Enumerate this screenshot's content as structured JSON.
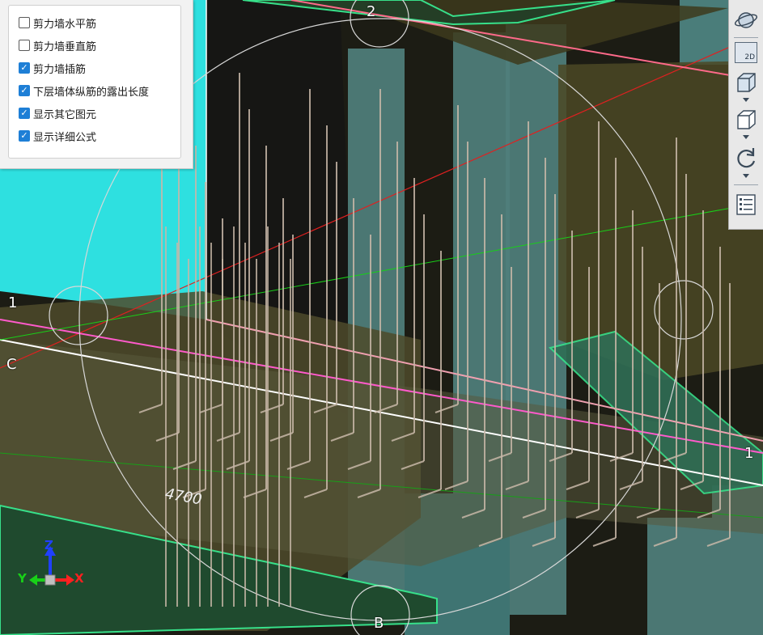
{
  "options": [
    {
      "label": "剪力墙水平筋",
      "checked": false
    },
    {
      "label": "剪力墙垂直筋",
      "checked": false
    },
    {
      "label": "剪力墙插筋",
      "checked": true
    },
    {
      "label": "下层墙体纵筋的露出长度",
      "checked": true
    },
    {
      "label": "显示其它图元",
      "checked": true
    },
    {
      "label": "显示详细公式",
      "checked": true
    }
  ],
  "viewport": {
    "grid_labels": {
      "top": "2",
      "left": "1",
      "right": "1",
      "left_axis": "C",
      "bottom": "B"
    },
    "dimension": "4700"
  },
  "axis_triad": {
    "x": "X",
    "y": "Y",
    "z": "Z"
  },
  "toolbar": {
    "items": [
      "orbit-icon",
      "view-2d-icon",
      "view-3d-box-icon",
      "view-cube-icon",
      "rotate-icon",
      "properties-list-icon"
    ],
    "view_2d_label": "2D"
  },
  "colors": {
    "sky": "#2ee0e0",
    "concrete": "#4f7f7c",
    "slab": "#4d4a2a",
    "rebar": "#c8b8a8",
    "accent": "#1e7fd6",
    "beam_edge": "#37e08a",
    "axis_x": "#ff2020",
    "axis_y": "#18d018",
    "axis_z": "#2040ff"
  }
}
